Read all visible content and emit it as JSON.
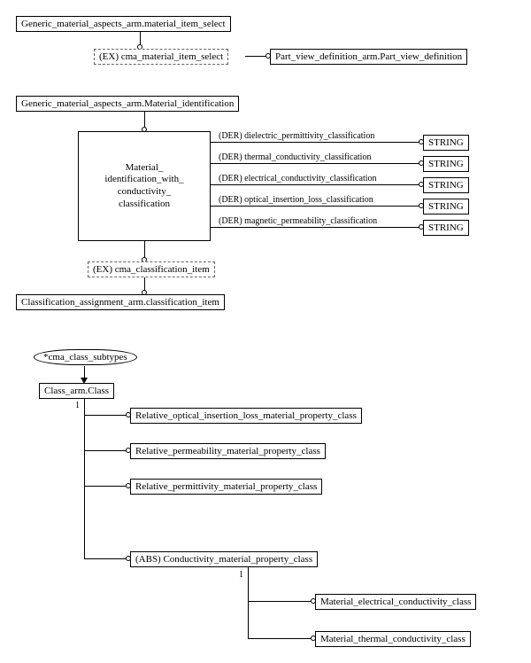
{
  "section1": {
    "top_box": "Generic_material_aspects_arm.material_item_select",
    "ex_box": "(EX) cma_material_item_select",
    "right_box": "Part_view_definition_arm.Part_view_definition"
  },
  "section2": {
    "top_box": "Generic_material_aspects_arm.Material_identification",
    "main_box": "Material_\nidentification_with_\nconductivity_\nclassification",
    "attrs": [
      {
        "label": "(DER) dielectric_permittivity_classification",
        "type": "STRING"
      },
      {
        "label": "(DER) thermal_conductivity_classification",
        "type": "STRING"
      },
      {
        "label": "(DER) electrical_conductivity_classification",
        "type": "STRING"
      },
      {
        "label": "(DER) optical_insertion_loss_classification",
        "type": "STRING"
      },
      {
        "label": "(DER) magnetic_permeability_classification",
        "type": "STRING"
      }
    ],
    "ex_box": "(EX) cma_classification_item",
    "bottom_box": "Classification_assignment_arm.classification_item"
  },
  "section3": {
    "oval": "*cma_class_subtypes",
    "class_box": "Class_arm.Class",
    "one": "1",
    "subclasses": [
      "Relative_optical_insertion_loss_material_property_class",
      "Relative_permeability_material_property_class",
      "Relative_permittivity_material_property_class",
      "(ABS) Conductivity_material_property_class"
    ],
    "conductivity_subs": [
      "Material_electrical_conductivity_class",
      "Material_thermal_conductivity_class"
    ]
  }
}
